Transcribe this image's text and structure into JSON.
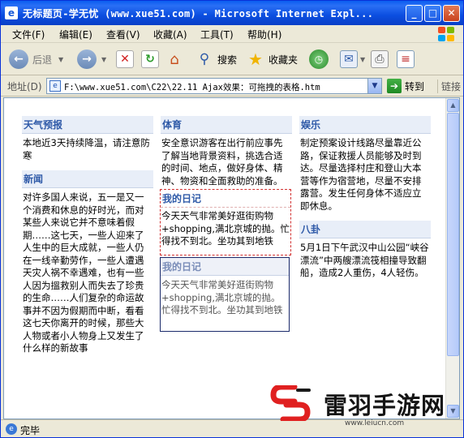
{
  "window": {
    "title": "无标题页-学无忧 (www.xue51.com) - Microsoft Internet Expl...",
    "minimize": "_",
    "maximize": "□",
    "close": "✕"
  },
  "menubar": {
    "items": [
      "文件(F)",
      "编辑(E)",
      "查看(V)",
      "收藏(A)",
      "工具(T)",
      "帮助(H)"
    ]
  },
  "toolbar": {
    "back_label": "后退",
    "search_label": "搜索",
    "favorites_label": "收藏夹"
  },
  "address": {
    "label": "地址(D)",
    "url": "F:\\www.xue51.com\\C22\\22.11  Ajax效果：可拖拽的表格.htm",
    "go_label": "转到",
    "links_label": "链接"
  },
  "columns": {
    "left": {
      "modules": [
        {
          "title": "天气预报",
          "body": "本地近3天持续降温，请注意防寒"
        },
        {
          "title": "新闻",
          "body": "对许多国人来说，五一是又一个消费和休息的好时光，而对某些人来说它并不意味着假期……这七天，一些人迎来了人生中的巨大成就，一些人仍在一线辛勤劳作，一些人遭遇天灾人祸不幸遇难，也有一些人因为搵救别人而失去了珍贵的生命……人们复杂的命运故事并不因为假期而中断，看看这七天你离开的时候，那些大人物或者小人物身上又发生了什么样的新故事"
        }
      ]
    },
    "middle": {
      "modules": [
        {
          "title": "体育",
          "body": "安全意识游客在出行前应事先了解当地背景资料，挑选合适的时间、地点，做好身体、精神、物资和全面救助的准备。"
        }
      ],
      "drag_placeholder": {
        "title": "我的日记",
        "body": "今天天气非常美好逛街购物+shopping,满北京城的抛。忙得找不到北。坐功其到地铁"
      },
      "drag_ghost": {
        "title": "我的日记",
        "body": "今天天气非常美好逛街购物+shopping,满北京城的抛。忙得找不到北。坐功其到地铁"
      }
    },
    "right": {
      "modules": [
        {
          "title": "娱乐",
          "body": "制定预案设计线路尽量靠近公路，保证救援人员能够及时到达。尽量选择村庄和登山大本营等作为宿营地，尽量不安排露营。发生任何身体不适应立即休息。"
        },
        {
          "title": "八卦",
          "body": "5月1日下午武汉中山公园“峡谷漂流”中两艘漂流筏相撞导致翻船，造成2人重伤，4人轻伤。"
        }
      ]
    }
  },
  "statusbar": {
    "text": "完毕"
  },
  "watermark": {
    "name": "雷羽手游网",
    "url": "www.leiucn.com"
  },
  "colors": {
    "title_blue": "#0a5ef0",
    "module_title": "#2f5aa8",
    "module_title_bg": "#e8eef8",
    "drag_border": "#d23030"
  }
}
